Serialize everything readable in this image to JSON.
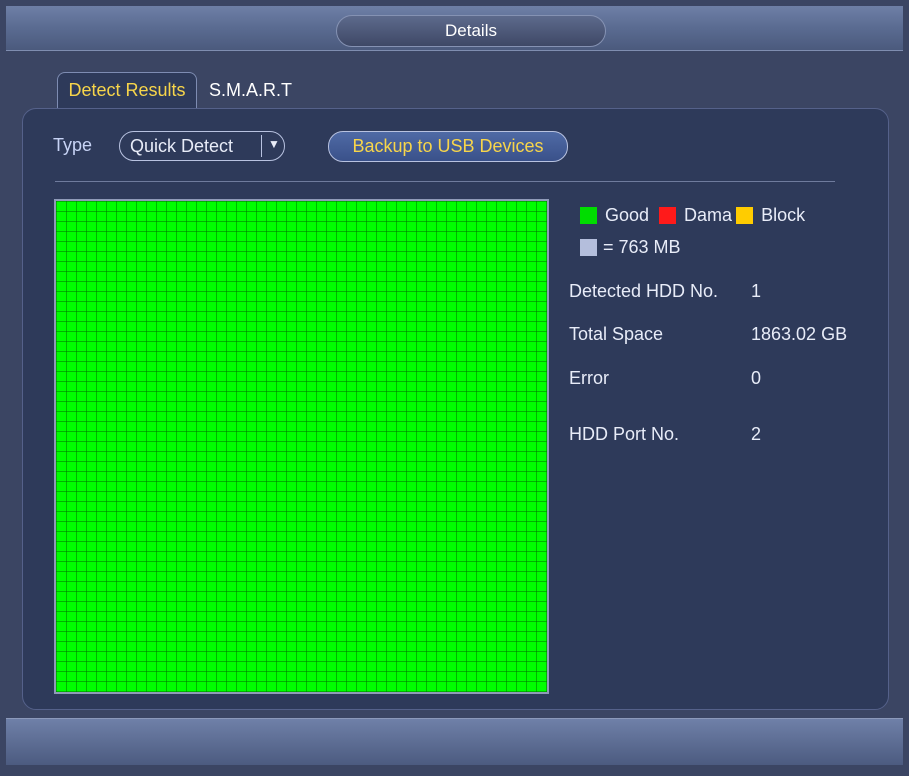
{
  "window": {
    "title": "Details"
  },
  "tabs": [
    {
      "label": "Detect Results",
      "active": true
    },
    {
      "label": "S.M.A.R.T",
      "active": false
    }
  ],
  "toolbar": {
    "type_label": "Type",
    "type_value": "Quick Detect",
    "backup_label": "Backup to USB Devices"
  },
  "legend": {
    "good": {
      "label": "Good",
      "color": "#00dd00"
    },
    "damaged": {
      "label": "Dama",
      "color": "#ff1a1a"
    },
    "block": {
      "label": "Block",
      "color": "#ffcc00"
    },
    "unit": {
      "label": "= 763 MB",
      "color": "#b4bedc"
    }
  },
  "info": {
    "detected_hdd_label": "Detected HDD No.",
    "detected_hdd_value": "1",
    "total_space_label": "Total Space",
    "total_space_value": "1863.02 GB",
    "error_label": "Error",
    "error_value": "0",
    "port_label": "HDD Port No.",
    "port_value": "2"
  },
  "colors": {
    "accent_text": "#f7d54a",
    "grid_good": "#00ff00"
  }
}
